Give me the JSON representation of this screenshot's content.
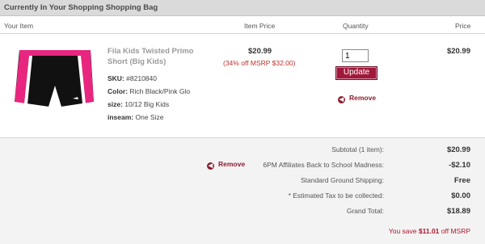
{
  "header": {
    "title": "Currently In Your Shopping Shopping Bag"
  },
  "columns": {
    "item": "Your Item",
    "item_price": "Item Price",
    "quantity": "Quantity",
    "price": "Price"
  },
  "item": {
    "name": "Fila Kids Twisted Primo Short (Big Kids)",
    "sku_label": "SKU:",
    "sku": "#8210840",
    "color_label": "Color:",
    "color": "Rich Black/Pink Glo",
    "size_label": "size:",
    "size": "10/12 Big Kids",
    "inseam_label": "inseam:",
    "inseam": "One Size",
    "item_price": "$20.99",
    "discount_note": "(34% off MSRP $32.00)",
    "quantity": "1",
    "update_label": "Update",
    "remove_label": "Remove",
    "line_price": "$20.99",
    "image_colors": {
      "body": "#111111",
      "accent": "#e8267f",
      "trim": "#ffffff"
    }
  },
  "summary": {
    "remove_label": "Remove",
    "rows": [
      {
        "label": "Subtotal (1 item):",
        "value": "$20.99"
      },
      {
        "label": "6PM Affiliates Back to School Madness:",
        "value": "-$2.10"
      },
      {
        "label": "Standard Ground Shipping:",
        "value": "Free"
      },
      {
        "label": "* Estimated Tax to be collected:",
        "value": "$0.00"
      },
      {
        "label": "Grand Total:",
        "value": "$18.89"
      }
    ],
    "savings_prefix": "You save",
    "savings_amount": "$11.01",
    "savings_suffix": "off MSRP"
  },
  "colors": {
    "brand": "#a0193a",
    "remove": "#8b1c2e",
    "savings": "#b0162c"
  }
}
